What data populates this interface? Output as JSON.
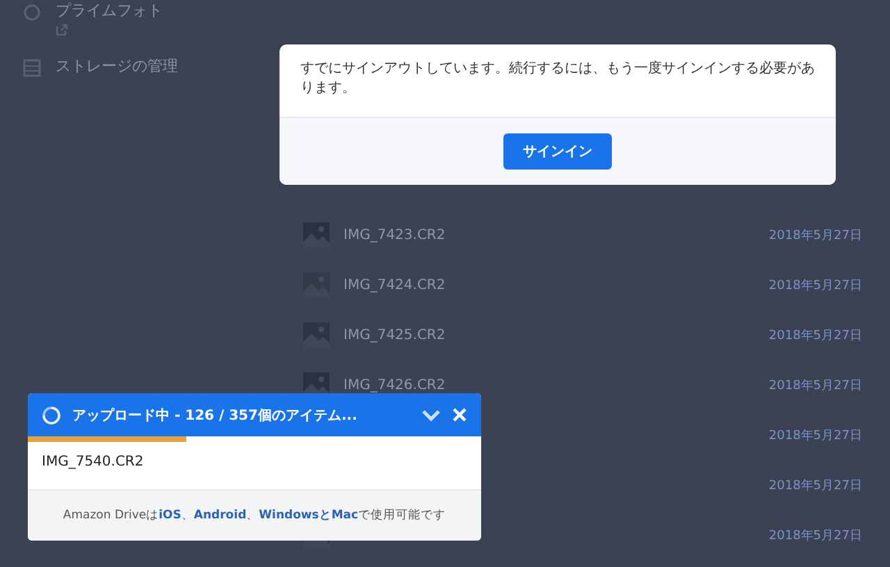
{
  "sidebar": {
    "items": [
      {
        "label": "プライムフォト",
        "external": true
      },
      {
        "label": "ストレージの管理"
      }
    ]
  },
  "files": [
    {
      "name": "IMG_7423.CR2",
      "date": "2018年5月27日"
    },
    {
      "name": "IMG_7424.CR2",
      "date": "2018年5月27日"
    },
    {
      "name": "IMG_7425.CR2",
      "date": "2018年5月27日"
    },
    {
      "name": "IMG_7426.CR2",
      "date": "2018年5月27日"
    },
    {
      "date": "2018年5月27日"
    },
    {
      "date": "2018年5月27日"
    },
    {
      "date": "2018年5月27日"
    }
  ],
  "dialog": {
    "message": "すでにサインアウトしています。続行するには、もう一度サインインする必要があります。",
    "button": "サインイン"
  },
  "upload": {
    "title": "アップロード中 - 126 / 357個のアイテム...",
    "level": 0.35,
    "current_file": "IMG_7540.CR2",
    "footer": [
      {
        "kind": "text",
        "text": "Amazon Driveは"
      },
      {
        "kind": "link",
        "text": "iOS"
      },
      {
        "kind": "text",
        "text": "、"
      },
      {
        "kind": "link",
        "text": "Android"
      },
      {
        "kind": "text",
        "text": "、"
      },
      {
        "kind": "link",
        "text": "WindowsとMac"
      },
      {
        "kind": "text",
        "text": "で使用可能です"
      }
    ]
  }
}
